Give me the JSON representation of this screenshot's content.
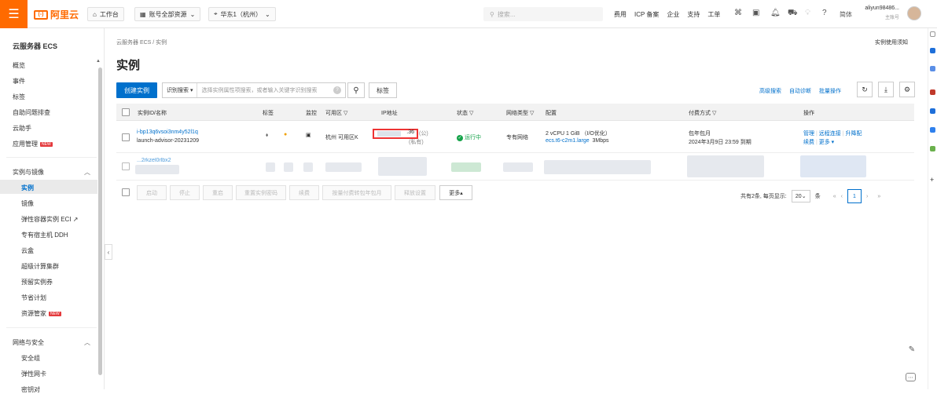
{
  "topbar": {
    "logo_text": "阿里云",
    "logo_badge": "(-)",
    "workbench": "工作台",
    "resource_group": "账号全部资源",
    "region": "华东1（杭州）",
    "search_placeholder": "搜索...",
    "links": [
      "费用",
      "ICP 备案",
      "企业",
      "支持",
      "工单"
    ],
    "lang": "简体",
    "user_name": "aliyun98486...",
    "user_role": "主账号"
  },
  "sidebar": {
    "title": "云服务器 ECS",
    "top_items": [
      "概览",
      "事件",
      "标签",
      "自助问题排查",
      "云助手",
      "应用管理"
    ],
    "new_badge": "NEW",
    "group1_title": "实例与镜像",
    "group1_items": [
      "实例",
      "镜像",
      "弹性容器实例 ECI",
      "专有宿主机 DDH",
      "云盒",
      "超级计算集群",
      "预留实例券",
      "节省计划",
      "资源管家"
    ],
    "group2_title": "网络与安全",
    "group2_items": [
      "安全组",
      "弹性网卡",
      "密钥对"
    ]
  },
  "main": {
    "breadcrumb": "云服务器 ECS / 实例",
    "notice": "实例使用须知",
    "title": "实例",
    "create_button": "创建实例",
    "filter_select": "识别搜索",
    "filter_placeholder": "选择实例属性项搜索，或者输入关键字识别搜索",
    "tag_button": "标签",
    "right_links": [
      "高级搜索",
      "自动诊断",
      "批量操作"
    ]
  },
  "table": {
    "headers": {
      "id": "实例ID/名称",
      "tag": "标签",
      "monitor": "监控",
      "zone": "可用区",
      "ip": "IP地址",
      "status": "状态",
      "network": "网络类型",
      "config": "配置",
      "billing": "付费方式",
      "ops": "操作"
    },
    "row1": {
      "id": "i-bp13q6vsoi3nm4y52l1q",
      "name": "launch-advisor-20231209",
      "zone": "杭州 可用区K",
      "ip_public": ".36",
      "ip_public_suffix": "(公)",
      "ip_private_suffix": "(私有)",
      "status": "运行中",
      "network": "专有网络",
      "config_line1": "2 vCPU 1 GiB （I/O优化）",
      "config_type": "ecs.t6-c2m1.large",
      "config_bw": "3Mbps",
      "billing_line1": "包年包月",
      "billing_line2": "2024年3月9日 23:59 到期",
      "ops_line1": [
        "管理",
        "远程连接",
        "升降配"
      ],
      "ops_line2": [
        "续费",
        "更多"
      ]
    },
    "row2": {
      "id_partial": "...2rkzel0rlbx2"
    }
  },
  "bottom": {
    "buttons": [
      "启动",
      "停止",
      "重启",
      "重置实例密码",
      "续费",
      "按量付费转包年包月",
      "释放设置"
    ],
    "more": "更多",
    "total": "共有2条, 每页显示:",
    "page_size": "20",
    "unit": "条",
    "current_page": "1"
  }
}
